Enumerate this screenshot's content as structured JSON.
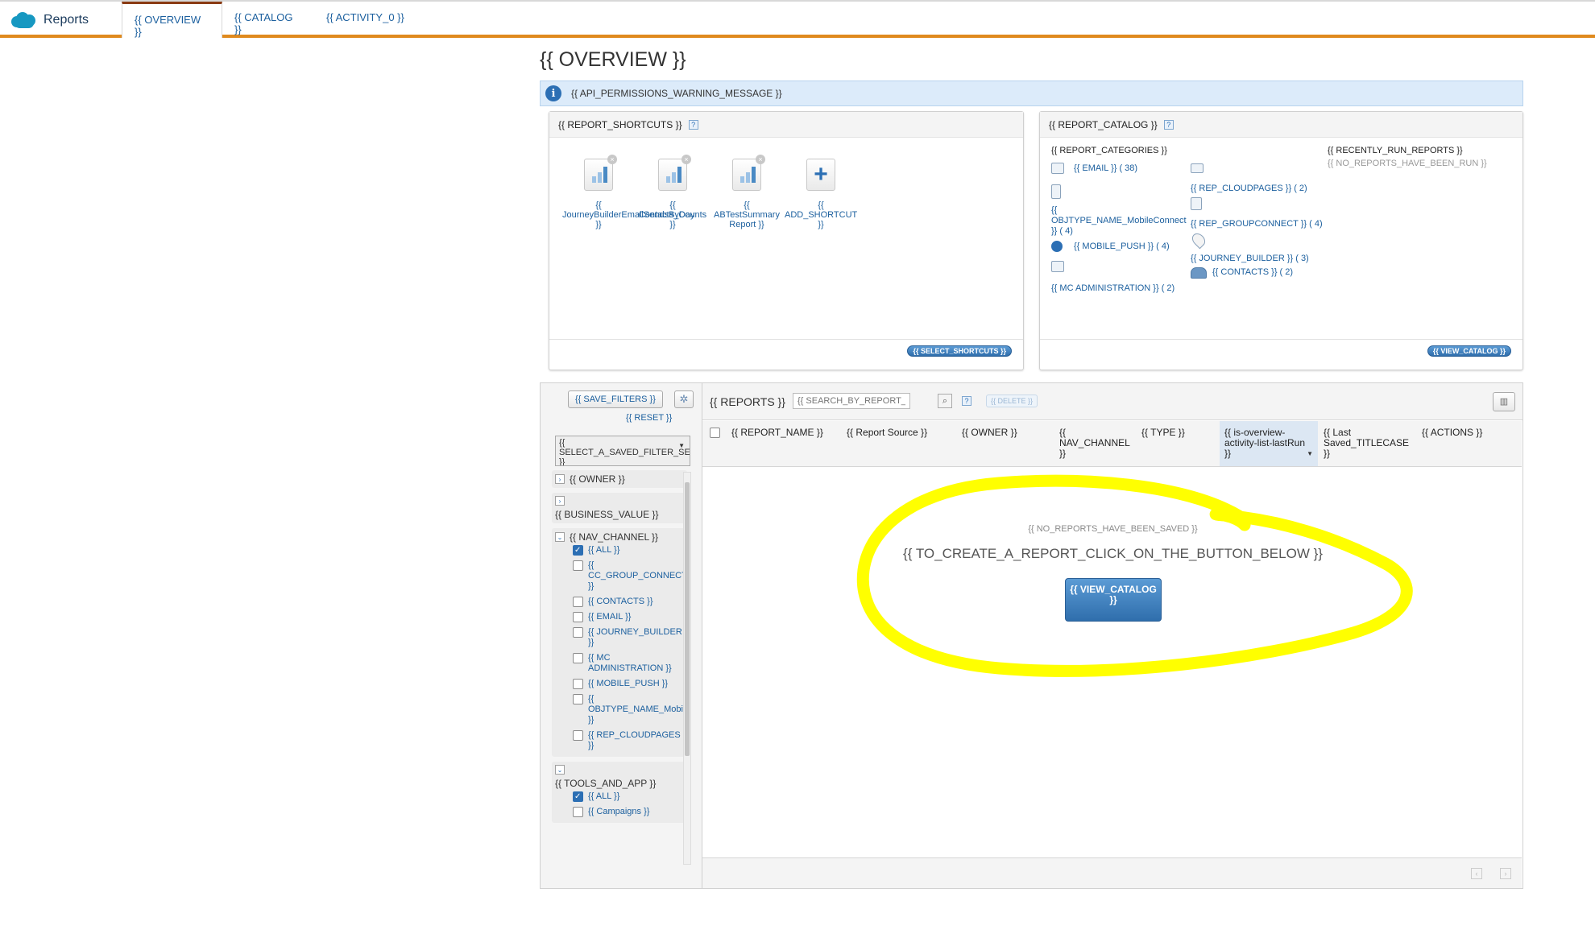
{
  "nav": {
    "brand": "Reports",
    "tabs": [
      "{{ OVERVIEW }}",
      "{{ CATALOG }}",
      "{{ ACTIVITY_0 }}"
    ]
  },
  "page_title": "{{ OVERVIEW }}",
  "warning": "{{ API_PERMISSIONS_WARNING_MESSAGE }}",
  "shortcuts": {
    "title": "{{ REPORT_SHORTCUTS }}",
    "items": [
      "{{ JourneyBuilderEmailSendsByDay }}",
      "{{ Contacts_Counts }}",
      "{{ ABTestSummary Report }}",
      "{{ ADD_SHORTCUT }}"
    ],
    "select_button": "{{ SELECT_SHORTCUTS }}"
  },
  "catalog": {
    "title": "{{ REPORT_CATALOG }}",
    "categories_heading": "{{ REPORT_CATEGORIES }}",
    "left_col": [
      {
        "label": "{{ EMAIL }} ( 38)",
        "icon": "email-icon"
      },
      {
        "label": "{{ OBJTYPE_NAME_MobileConnect }} ( 4)",
        "icon": "mobile-icon"
      },
      {
        "label": "{{ MOBILE_PUSH }} ( 4)",
        "icon": "info-icon"
      },
      {
        "label": "{{ MC ADMINISTRATION }} ( 2)",
        "icon": "chart-icon"
      }
    ],
    "right_col": [
      {
        "label": "{{ REP_CLOUDPAGES }} ( 2)",
        "icon": "page-icon"
      },
      {
        "label": "{{ REP_GROUPCONNECT }} ( 4)",
        "icon": "link-icon"
      },
      {
        "label": "{{ JOURNEY_BUILDER }} ( 3)",
        "icon": "map-pin-icon"
      },
      {
        "label": "{{ CONTACTS }} ( 2)",
        "icon": "people-icon"
      }
    ],
    "recent_heading": "{{ RECENTLY_RUN_REPORTS }}",
    "recent_empty": "{{ NO_REPORTS_HAVE_BEEN_RUN }}",
    "view_button": "{{ VIEW_CATALOG }}"
  },
  "filters": {
    "save": "{{ SAVE_FILTERS }}",
    "reset": "{{ RESET }}",
    "select_saved": "{{ SELECT_A_SAVED_FILTER_SET }}",
    "owner": "{{ OWNER }}",
    "business_value": "{{ BUSINESS_VALUE }}",
    "nav_channel": "{{ NAV_CHANNEL }}",
    "nav_items": [
      "{{ ALL }}",
      "{{ CC_GROUP_CONNECT }}",
      "{{ CONTACTS }}",
      "{{ EMAIL }}",
      "{{ JOURNEY_BUILDER }}",
      "{{ MC ADMINISTRATION }}",
      "{{ MOBILE_PUSH }}",
      "{{ OBJTYPE_NAME_MobileConnect }}",
      "{{ REP_CLOUDPAGES }}"
    ],
    "tools_and_app": "{{ TOOLS_AND_APP }}",
    "tools_items": [
      "{{ ALL }}",
      "{{ Campaigns }}"
    ]
  },
  "reports": {
    "title": "{{ REPORTS }}",
    "search_placeholder": "{{ SEARCH_BY_REPORT_NAME",
    "delete": "{{ DELETE }}",
    "columns": [
      "{{ REPORT_NAME }}",
      "{{ Report Source }}",
      "{{ OWNER }}",
      "{{ NAV_CHANNEL }}",
      "{{ TYPE }}",
      "{{ is-overview-activity-list-lastRun }}",
      "{{ Last Saved_TITLECASE }}",
      "{{ ACTIONS }}"
    ],
    "no_saved": "{{ NO_REPORTS_HAVE_BEEN_SAVED }}",
    "to_create": "{{ TO_CREATE_A_REPORT_CLICK_ON_THE_BUTTON_BELOW }}",
    "view_catalog": "{{ VIEW_CATALOG }}"
  },
  "colors": {
    "accent_orange": "#e08a1e",
    "link_blue": "#1b5f9e",
    "highlight_yellow": "#ffff00"
  }
}
